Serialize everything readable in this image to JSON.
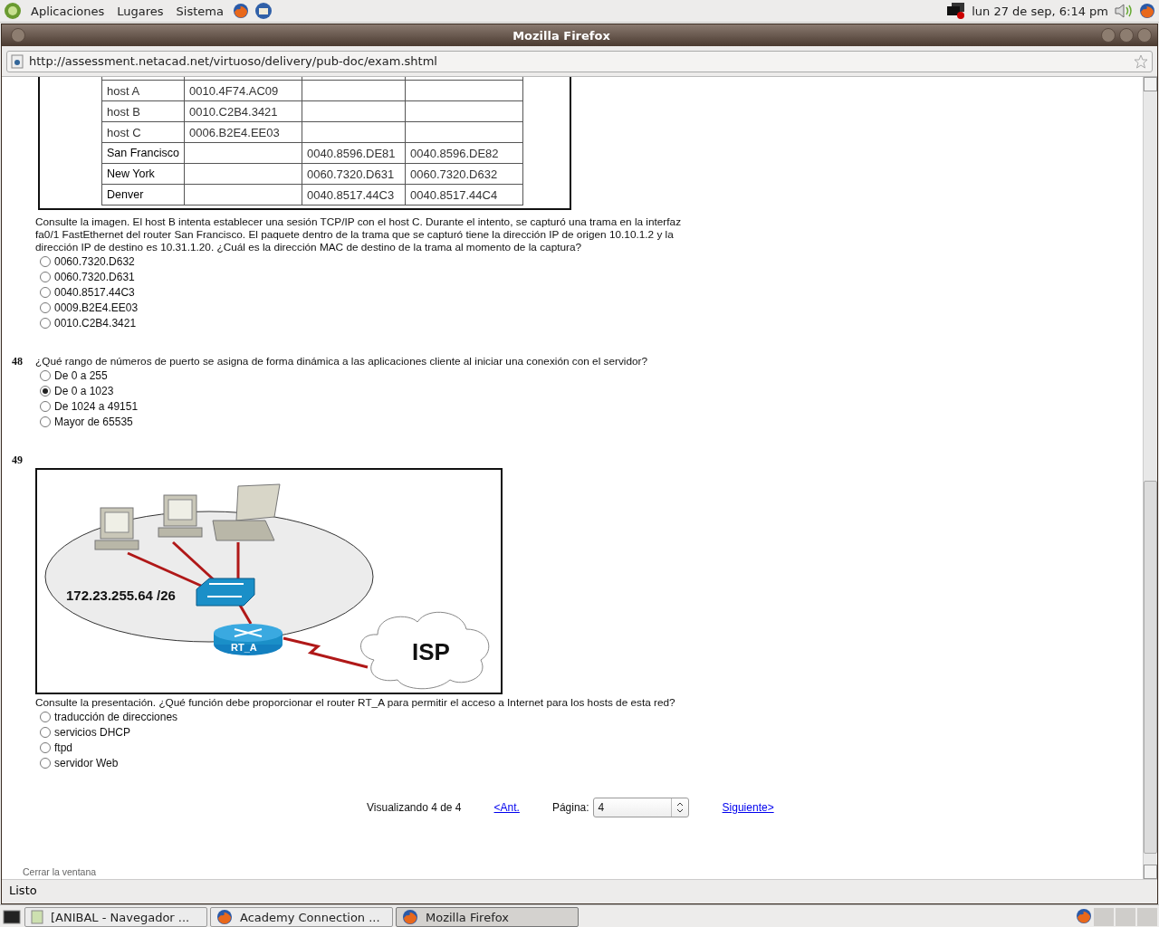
{
  "top_panel": {
    "menus": [
      "Aplicaciones",
      "Lugares",
      "Sistema"
    ],
    "clock": "lun 27 de sep,  6:14 pm"
  },
  "window": {
    "title": "Mozilla Firefox"
  },
  "address_bar": {
    "url": "http://assessment.netacad.net/virtuoso/delivery/pub-doc/exam.shtml"
  },
  "mac_table": {
    "rows": [
      {
        "name": "host A",
        "kind": "host",
        "column_2": "0010.4F74.AC09"
      },
      {
        "name": "host B",
        "kind": "host",
        "column_2": "0010.C2B4.3421"
      },
      {
        "name": "host C",
        "kind": "host",
        "column_2": "0006.B2E4.EE03"
      },
      {
        "name": "San Francisco",
        "kind": "router",
        "column_3": "0040.8596.DE81",
        "column_4": "0040.8596.DE82"
      },
      {
        "name": "New York",
        "kind": "router",
        "column_3": "0060.7320.D631",
        "column_4": "0060.7320.D632"
      },
      {
        "name": "Denver",
        "kind": "router",
        "column_3": "0040.8517.44C3",
        "column_4": "0040.8517.44C4"
      }
    ]
  },
  "questions": [
    {
      "text": "Consulte la imagen. El host B intenta establecer una sesión TCP/IP con el host C. Durante el intento, se capturó una trama en la interfaz fa0/1 FastEthernet del router San Francisco. El paquete dentro de la trama que se capturó tiene la dirección IP de origen 10.10.1.2 y la dirección IP de destino es 10.31.1.20. ¿Cuál es la dirección MAC de destino de la trama al momento de la captura?",
      "options": [
        {
          "label": "0060.7320.D632",
          "selected": false
        },
        {
          "label": "0060.7320.D631",
          "selected": false
        },
        {
          "label": "0040.8517.44C3",
          "selected": false
        },
        {
          "label": "0009.B2E4.EE03",
          "selected": false
        },
        {
          "label": "0010.C2B4.3421",
          "selected": false
        }
      ]
    },
    {
      "number": "48",
      "text": "¿Qué rango de números de puerto se asigna de forma dinámica a las aplicaciones cliente al iniciar una conexión con el servidor?",
      "options": [
        {
          "label": "De 0 a 255",
          "selected": false
        },
        {
          "label": "De 0 a 1023",
          "selected": true
        },
        {
          "label": "De 1024 a 49151",
          "selected": false
        },
        {
          "label": "Mayor de 65535",
          "selected": false
        }
      ]
    },
    {
      "number": "49",
      "diagram": {
        "subnet_label": "172.23.255.64 /26",
        "router_label": "RT_A",
        "cloud_label": "ISP"
      },
      "text": "Consulte la presentación. ¿Qué función debe proporcionar el router RT_A para permitir el acceso a Internet para los hosts de esta red?",
      "options": [
        {
          "label": "traducción de direcciones",
          "selected": false
        },
        {
          "label": "servicios DHCP",
          "selected": false
        },
        {
          "label": "ftpd",
          "selected": false
        },
        {
          "label": "servidor Web",
          "selected": false
        }
      ]
    }
  ],
  "pagination": {
    "summary": "Visualizando 4 de 4",
    "prev": "<Ant.",
    "page_label": "Página:",
    "page_value": "4",
    "next": "Siguiente>"
  },
  "close_link": "Cerrar la ventana",
  "status_bar": "Listo",
  "taskbar": [
    {
      "label": "[ANIBAL - Navegador ...",
      "selected": false
    },
    {
      "label": "Academy Connection ...",
      "selected": false
    },
    {
      "label": "Mozilla Firefox",
      "selected": true
    }
  ]
}
